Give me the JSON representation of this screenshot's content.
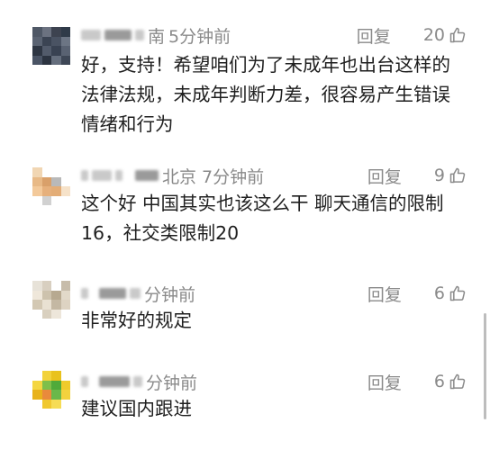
{
  "comments": [
    {
      "location": "南",
      "time": "5分钟前",
      "reply_label": "回复",
      "likes": "20",
      "text": "好，支持！希望咱们为了未成年也出台这样的法律法规，未成年判断力差，很容易产生错误情绪和行为"
    },
    {
      "location": "北京",
      "time": "7分钟前",
      "reply_label": "回复",
      "likes": "9",
      "text": "这个好 中国其实也该这么干 聊天通信的限制16，社交类限制20"
    },
    {
      "location": "",
      "time": "分钟前",
      "reply_label": "回复",
      "likes": "6",
      "text": "非常好的规定"
    },
    {
      "location": "",
      "time": "分钟前",
      "reply_label": "回复",
      "likes": "6",
      "text": "建议国内跟进"
    }
  ],
  "icons": {
    "like": "thumbs-up-icon"
  },
  "colors": {
    "meta_text": "#8a8a8a",
    "body_text": "#1f1f1f",
    "background": "#ffffff"
  }
}
